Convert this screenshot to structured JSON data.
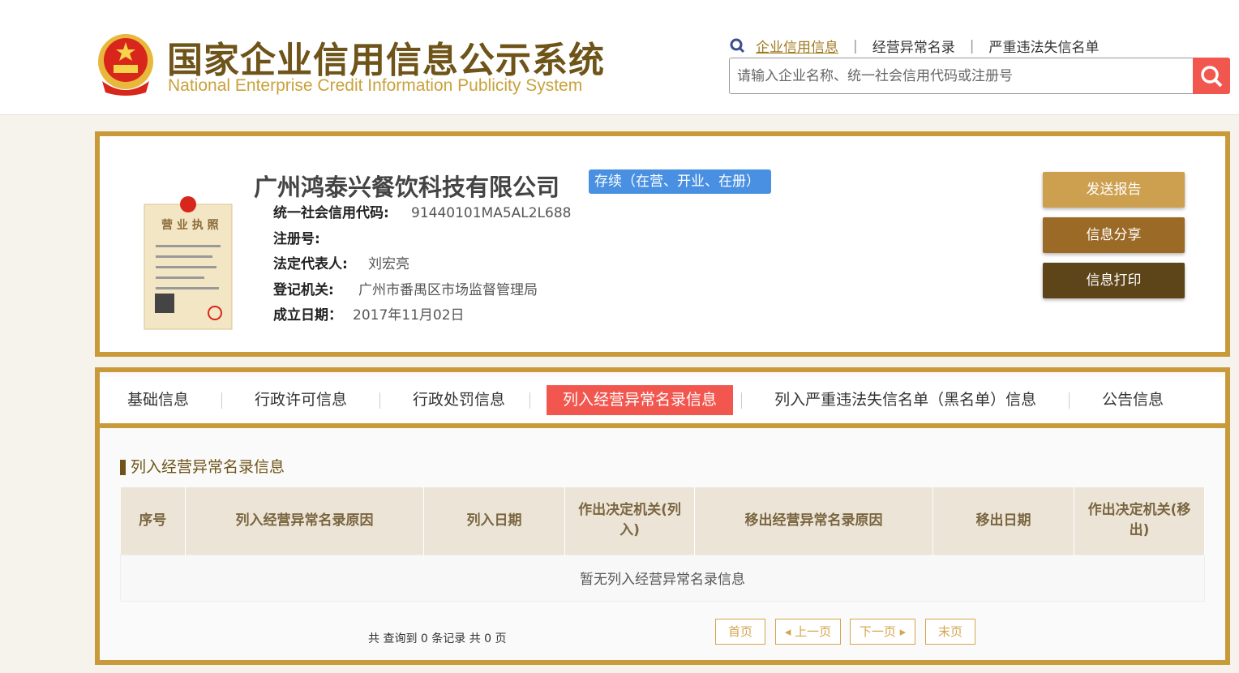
{
  "header": {
    "title_cn": "国家企业信用信息公示系统",
    "title_en": "National Enterprise Credit Information Publicity System",
    "links": [
      "企业信用信息",
      "经营异常名录",
      "严重违法失信名单"
    ],
    "search_placeholder": "请输入企业名称、统一社会信用代码或注册号"
  },
  "company": {
    "name": "广州鸿泰兴餐饮科技有限公司",
    "status": "存续（在营、开业、在册）",
    "fields": [
      {
        "label": "统一社会信用代码:",
        "value": "91440101MA5AL2L688"
      },
      {
        "label": "注册号:",
        "value": ""
      },
      {
        "label": "法定代表人:",
        "value": "刘宏亮"
      },
      {
        "label": "登记机关:",
        "value": "广州市番禺区市场监督管理局"
      },
      {
        "label": "成立日期：",
        "value": "2017年11月02日"
      }
    ],
    "buttons": [
      "发送报告",
      "信息分享",
      "信息打印"
    ]
  },
  "tabs": [
    "基础信息",
    "行政许可信息",
    "行政处罚信息",
    "列入经营异常名录信息",
    "列入严重违法失信名单（黑名单）信息",
    "公告信息"
  ],
  "section": {
    "title": "列入经营异常名录信息",
    "columns": [
      "序号",
      "列入经营异常名录原因",
      "列入日期",
      "作出决定机关(列入)",
      "移出经营异常名录原因",
      "移出日期",
      "作出决定机关(移出)"
    ],
    "empty": "暂无列入经营异常名录信息"
  },
  "pagination": {
    "total": "共 查询到 0 条记录 共 0 页",
    "first": "首页",
    "prev": "上一页",
    "next": "下一页",
    "last": "末页"
  },
  "colors": {
    "gold": "#c99a3a",
    "red": "#f2574f",
    "blue": "#4a90e2"
  }
}
